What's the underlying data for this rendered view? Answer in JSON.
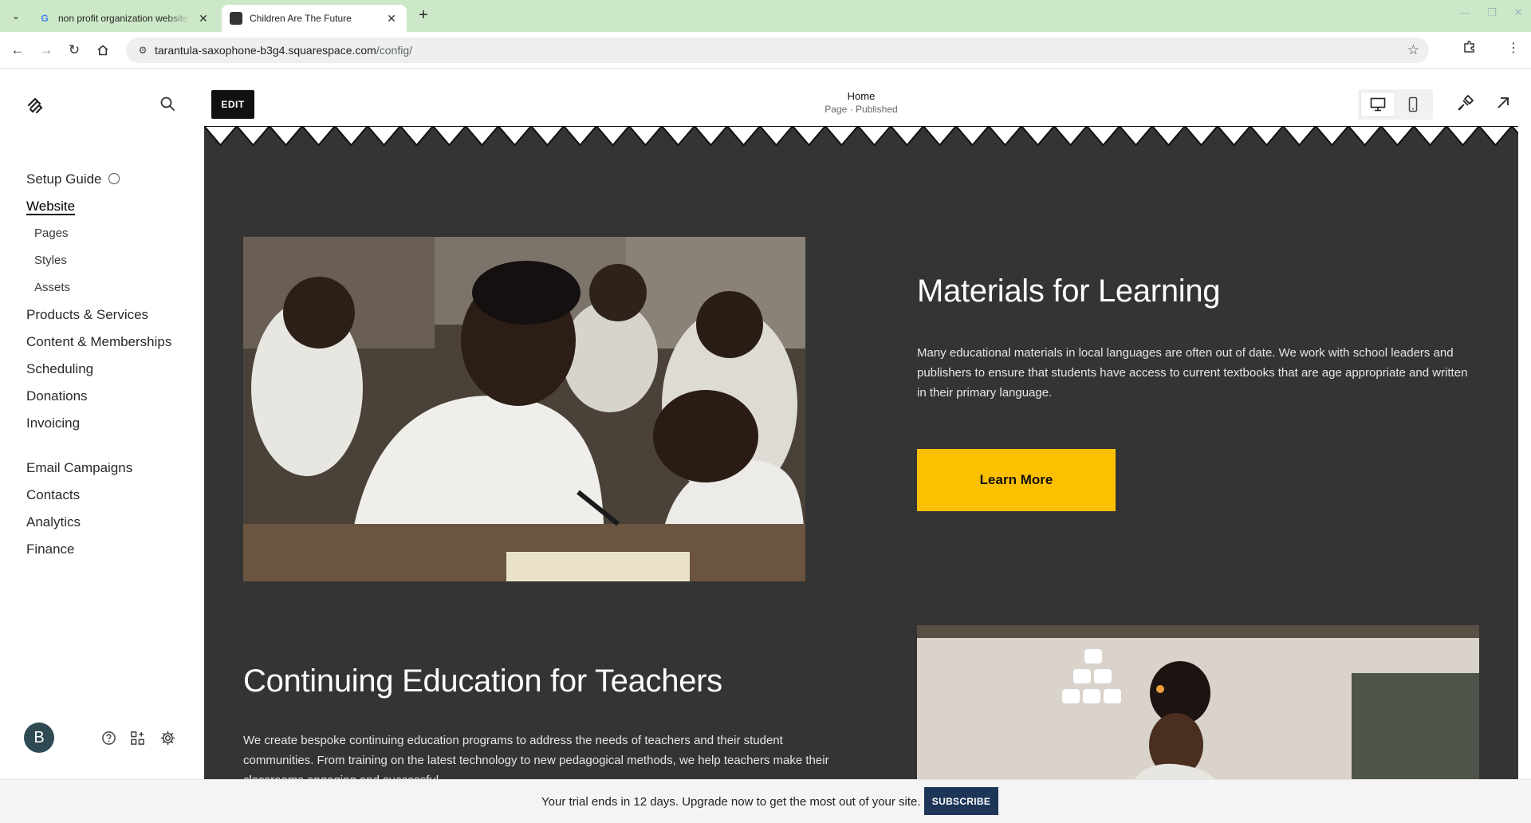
{
  "browser": {
    "tabs": [
      {
        "title": "non profit organization website",
        "icon": "google-g-icon",
        "active": false
      },
      {
        "title": "Children Are The Future",
        "icon": "squarespace-icon",
        "active": true
      }
    ],
    "url_host": "tarantula-saxophone-b3g4.squarespace.com",
    "url_path": "/config/"
  },
  "sidebar": {
    "setup_guide": "Setup Guide",
    "website": "Website",
    "website_sub": [
      "Pages",
      "Styles",
      "Assets"
    ],
    "group1": [
      "Products & Services",
      "Content & Memberships",
      "Scheduling",
      "Donations",
      "Invoicing"
    ],
    "group2": [
      "Email Campaigns",
      "Contacts",
      "Analytics",
      "Finance"
    ],
    "avatar_initial": "B"
  },
  "editor": {
    "edit_label": "EDIT",
    "page_name": "Home",
    "page_status": "Page · Published"
  },
  "content": {
    "section1": {
      "heading": "Materials for Learning",
      "body": "Many educational materials in local languages are often out of date. We work with school leaders and publishers to ensure that students have access to current textbooks that are age appropriate and written in their primary language.",
      "button": "Learn More"
    },
    "section2": {
      "heading": "Continuing Education for Teachers",
      "body": "We create bespoke continuing education programs to address the needs of teachers and their student communities. From training on the latest technology to new pedagogical methods, we help teachers make their classrooms engaging and successful."
    }
  },
  "trial": {
    "text": "Your trial ends in 12 days. Upgrade now to get the most out of your site.",
    "button": "SUBSCRIBE"
  },
  "colors": {
    "tabbar": "#cde8c8",
    "section_bg": "#343434",
    "accent_button": "#fcc000",
    "subscribe": "#1d3557"
  }
}
